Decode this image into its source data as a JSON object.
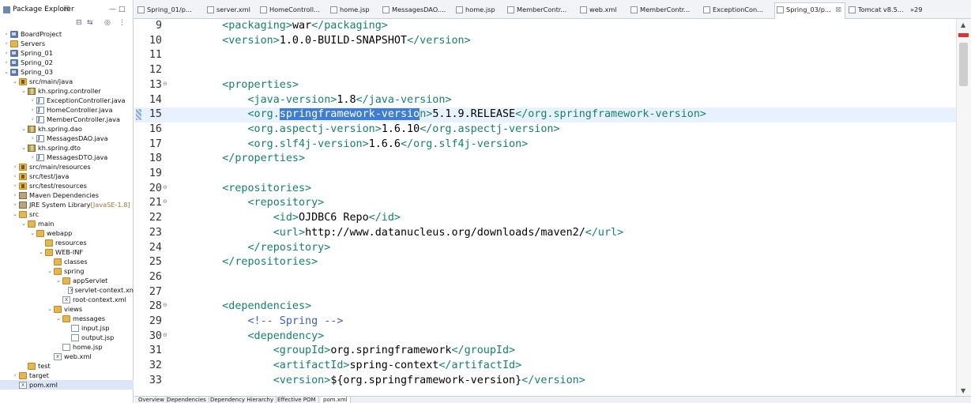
{
  "explorer": {
    "title": "Package Explorer",
    "close_label": "☒",
    "tree": [
      {
        "label": "BoardProject",
        "icon": "project-icon",
        "depth": 0,
        "twisty": ">"
      },
      {
        "label": "Servers",
        "icon": "folder-icon",
        "depth": 0,
        "twisty": ">"
      },
      {
        "label": "Spring_01",
        "icon": "project-icon",
        "depth": 0,
        "twisty": ">"
      },
      {
        "label": "Spring_02",
        "icon": "project-icon",
        "depth": 0,
        "twisty": ">"
      },
      {
        "label": "Spring_03",
        "icon": "project-icon",
        "depth": 0,
        "twisty": "v"
      },
      {
        "label": "src/main/java",
        "icon": "srcfolder-icon",
        "depth": 1,
        "twisty": "v"
      },
      {
        "label": "kh.spring.controller",
        "icon": "package-icon",
        "depth": 2,
        "twisty": "v"
      },
      {
        "label": "ExceptionController.java",
        "icon": "java-icon",
        "depth": 3,
        "twisty": ">"
      },
      {
        "label": "HomeController.java",
        "icon": "java-icon",
        "depth": 3,
        "twisty": ">"
      },
      {
        "label": "MemberController.java",
        "icon": "java-icon",
        "depth": 3,
        "twisty": ">"
      },
      {
        "label": "kh.spring.dao",
        "icon": "package-icon",
        "depth": 2,
        "twisty": "v"
      },
      {
        "label": "MessagesDAO.java",
        "icon": "java-icon",
        "depth": 3,
        "twisty": ">"
      },
      {
        "label": "kh.spring.dto",
        "icon": "package-icon",
        "depth": 2,
        "twisty": "v"
      },
      {
        "label": "MessagesDTO.java",
        "icon": "java-icon",
        "depth": 3,
        "twisty": ">"
      },
      {
        "label": "src/main/resources",
        "icon": "srcfolder-icon",
        "depth": 1,
        "twisty": ">"
      },
      {
        "label": "src/test/java",
        "icon": "srcfolder-icon",
        "depth": 1,
        "twisty": ">"
      },
      {
        "label": "src/test/resources",
        "icon": "srcfolder-icon",
        "depth": 1,
        "twisty": ">"
      },
      {
        "label": "Maven Dependencies",
        "icon": "library-icon",
        "depth": 1,
        "twisty": ">"
      },
      {
        "label": "JRE System Library",
        "suffix": " [JavaSE-1.8]",
        "icon": "library-icon",
        "depth": 1,
        "twisty": ">"
      },
      {
        "label": "src",
        "icon": "folder-icon",
        "depth": 1,
        "twisty": "v"
      },
      {
        "label": "main",
        "icon": "folder-icon",
        "depth": 2,
        "twisty": "v"
      },
      {
        "label": "webapp",
        "icon": "folder-icon",
        "depth": 3,
        "twisty": "v"
      },
      {
        "label": "resources",
        "icon": "folder-icon",
        "depth": 4,
        "twisty": ""
      },
      {
        "label": "WEB-INF",
        "icon": "folder-icon",
        "depth": 4,
        "twisty": "v"
      },
      {
        "label": "classes",
        "icon": "folder-icon",
        "depth": 5,
        "twisty": ""
      },
      {
        "label": "spring",
        "icon": "folder-icon",
        "depth": 5,
        "twisty": "v"
      },
      {
        "label": "appServlet",
        "icon": "folder-icon",
        "depth": 6,
        "twisty": "v"
      },
      {
        "label": "servlet-context.xn",
        "icon": "xml-icon",
        "depth": 7,
        "twisty": ""
      },
      {
        "label": "root-context.xml",
        "icon": "xml-icon",
        "depth": 6,
        "twisty": ""
      },
      {
        "label": "views",
        "icon": "folder-icon",
        "depth": 5,
        "twisty": "v"
      },
      {
        "label": "messages",
        "icon": "folder-icon",
        "depth": 6,
        "twisty": "v"
      },
      {
        "label": "input.jsp",
        "icon": "file-icon",
        "depth": 7,
        "twisty": ""
      },
      {
        "label": "output.jsp",
        "icon": "file-icon",
        "depth": 7,
        "twisty": ""
      },
      {
        "label": "home.jsp",
        "icon": "file-icon",
        "depth": 6,
        "twisty": ""
      },
      {
        "label": "web.xml",
        "icon": "xml-icon",
        "depth": 5,
        "twisty": ""
      },
      {
        "label": "test",
        "icon": "folder-icon",
        "depth": 2,
        "twisty": ""
      },
      {
        "label": "target",
        "icon": "folder-icon",
        "depth": 1,
        "twisty": ">"
      },
      {
        "label": "pom.xml",
        "icon": "xml-icon",
        "depth": 1,
        "twisty": "",
        "selected": true
      }
    ]
  },
  "tabs": [
    {
      "label": "Spring_01/p...",
      "icon": "xml-icon"
    },
    {
      "label": "server.xml",
      "icon": "xml-icon"
    },
    {
      "label": "HomeControll...",
      "icon": "java-icon"
    },
    {
      "label": "home.jsp",
      "icon": "file-icon"
    },
    {
      "label": "MessagesDAO....",
      "icon": "java-icon"
    },
    {
      "label": "home.jsp",
      "icon": "file-icon"
    },
    {
      "label": "MemberContr...",
      "icon": "java-icon"
    },
    {
      "label": "web.xml",
      "icon": "xml-icon"
    },
    {
      "label": "MemberContr...",
      "icon": "java-icon"
    },
    {
      "label": "ExceptionCon...",
      "icon": "java-icon"
    },
    {
      "label": "Spring_03/p...",
      "icon": "xml-icon",
      "active": true,
      "close": "☒"
    },
    {
      "label": "Tomcat v8.5...",
      "icon": "server-icon"
    },
    {
      "label": "»29",
      "icon": ""
    }
  ],
  "editor": {
    "lines": [
      {
        "num": "9",
        "fold": "",
        "tokens": [
          [
            "    ",
            ""
          ],
          [
            "<packaging>",
            "tg"
          ],
          [
            "war",
            "txt"
          ],
          [
            "</packaging>",
            "tg"
          ]
        ]
      },
      {
        "num": "10",
        "fold": "",
        "tokens": [
          [
            "    ",
            ""
          ],
          [
            "<version>",
            "tg"
          ],
          [
            "1.0.0-BUILD-SNAPSHOT",
            "txt"
          ],
          [
            "</version>",
            "tg"
          ]
        ]
      },
      {
        "num": "11",
        "fold": "",
        "tokens": []
      },
      {
        "num": "12",
        "fold": "",
        "tokens": []
      },
      {
        "num": "13",
        "fold": "⊖",
        "tokens": [
          [
            "    ",
            ""
          ],
          [
            "<properties>",
            "tg"
          ]
        ]
      },
      {
        "num": "14",
        "fold": "",
        "tokens": [
          [
            "        ",
            ""
          ],
          [
            "<java-version>",
            "tg"
          ],
          [
            "1.8",
            "txt"
          ],
          [
            "</java-version>",
            "tg"
          ]
        ]
      },
      {
        "num": "15",
        "fold": "",
        "current": true,
        "tokens": [
          [
            "        ",
            ""
          ],
          [
            "<org.",
            "tg"
          ],
          [
            "springframework-versio",
            "sel"
          ],
          [
            "n>",
            "tg"
          ],
          [
            "5.1.9.RELEASE",
            "txt"
          ],
          [
            "</org.springframework-version>",
            "tg"
          ]
        ]
      },
      {
        "num": "16",
        "fold": "",
        "tokens": [
          [
            "        ",
            ""
          ],
          [
            "<org.aspectj-version>",
            "tg"
          ],
          [
            "1.6.10",
            "txt"
          ],
          [
            "</org.aspectj-version>",
            "tg"
          ]
        ]
      },
      {
        "num": "17",
        "fold": "",
        "tokens": [
          [
            "        ",
            ""
          ],
          [
            "<org.slf4j-version>",
            "tg"
          ],
          [
            "1.6.6",
            "txt"
          ],
          [
            "</org.slf4j-version>",
            "tg"
          ]
        ]
      },
      {
        "num": "18",
        "fold": "",
        "tokens": [
          [
            "    ",
            ""
          ],
          [
            "</properties>",
            "tg"
          ]
        ]
      },
      {
        "num": "19",
        "fold": "",
        "tokens": []
      },
      {
        "num": "20",
        "fold": "⊖",
        "tokens": [
          [
            "    ",
            ""
          ],
          [
            "<repositories>",
            "tg"
          ]
        ]
      },
      {
        "num": "21",
        "fold": "⊖",
        "tokens": [
          [
            "        ",
            ""
          ],
          [
            "<repository>",
            "tg"
          ]
        ]
      },
      {
        "num": "22",
        "fold": "",
        "tokens": [
          [
            "            ",
            ""
          ],
          [
            "<id>",
            "tg"
          ],
          [
            "OJDBC6 Repo",
            "txt"
          ],
          [
            "</id>",
            "tg"
          ]
        ]
      },
      {
        "num": "23",
        "fold": "",
        "tokens": [
          [
            "            ",
            ""
          ],
          [
            "<url>",
            "tg"
          ],
          [
            "http://www.datanucleus.org/downloads/maven2/",
            "txt"
          ],
          [
            "</url>",
            "tg"
          ]
        ]
      },
      {
        "num": "24",
        "fold": "",
        "tokens": [
          [
            "        ",
            ""
          ],
          [
            "</repository>",
            "tg"
          ]
        ]
      },
      {
        "num": "25",
        "fold": "",
        "tokens": [
          [
            "    ",
            ""
          ],
          [
            "</repositories>",
            "tg"
          ]
        ]
      },
      {
        "num": "26",
        "fold": "",
        "tokens": []
      },
      {
        "num": "27",
        "fold": "",
        "tokens": []
      },
      {
        "num": "28",
        "fold": "⊖",
        "tokens": [
          [
            "    ",
            ""
          ],
          [
            "<dependencies>",
            "tg"
          ]
        ]
      },
      {
        "num": "29",
        "fold": "",
        "tokens": [
          [
            "        ",
            ""
          ],
          [
            "<!-- Spring -->",
            "cm"
          ]
        ]
      },
      {
        "num": "30",
        "fold": "⊖",
        "tokens": [
          [
            "        ",
            ""
          ],
          [
            "<dependency>",
            "tg"
          ]
        ]
      },
      {
        "num": "31",
        "fold": "",
        "tokens": [
          [
            "            ",
            ""
          ],
          [
            "<groupId>",
            "tg"
          ],
          [
            "org.springframework",
            "txt"
          ],
          [
            "</groupId>",
            "tg"
          ]
        ]
      },
      {
        "num": "32",
        "fold": "",
        "tokens": [
          [
            "            ",
            ""
          ],
          [
            "<artifactId>",
            "tg"
          ],
          [
            "spring-context",
            "txt"
          ],
          [
            "</artifactId>",
            "tg"
          ]
        ]
      },
      {
        "num": "33",
        "fold": "",
        "tokens": [
          [
            "            ",
            ""
          ],
          [
            "<version>",
            "tg"
          ],
          [
            "${org.springframework-version}",
            "txt"
          ],
          [
            "</version>",
            "tg"
          ]
        ]
      }
    ]
  },
  "bottom_tabs": [
    {
      "label": "Overview"
    },
    {
      "label": "Dependencies"
    },
    {
      "label": "Dependency Hierarchy"
    },
    {
      "label": "Effective POM"
    },
    {
      "label": "pom.xml",
      "active": true
    }
  ],
  "colors": {
    "tag": "#17806d",
    "text": "#000000",
    "comment": "#3f5fbf",
    "selection": "#3d7dd8",
    "current_line": "#e8f2fe"
  }
}
